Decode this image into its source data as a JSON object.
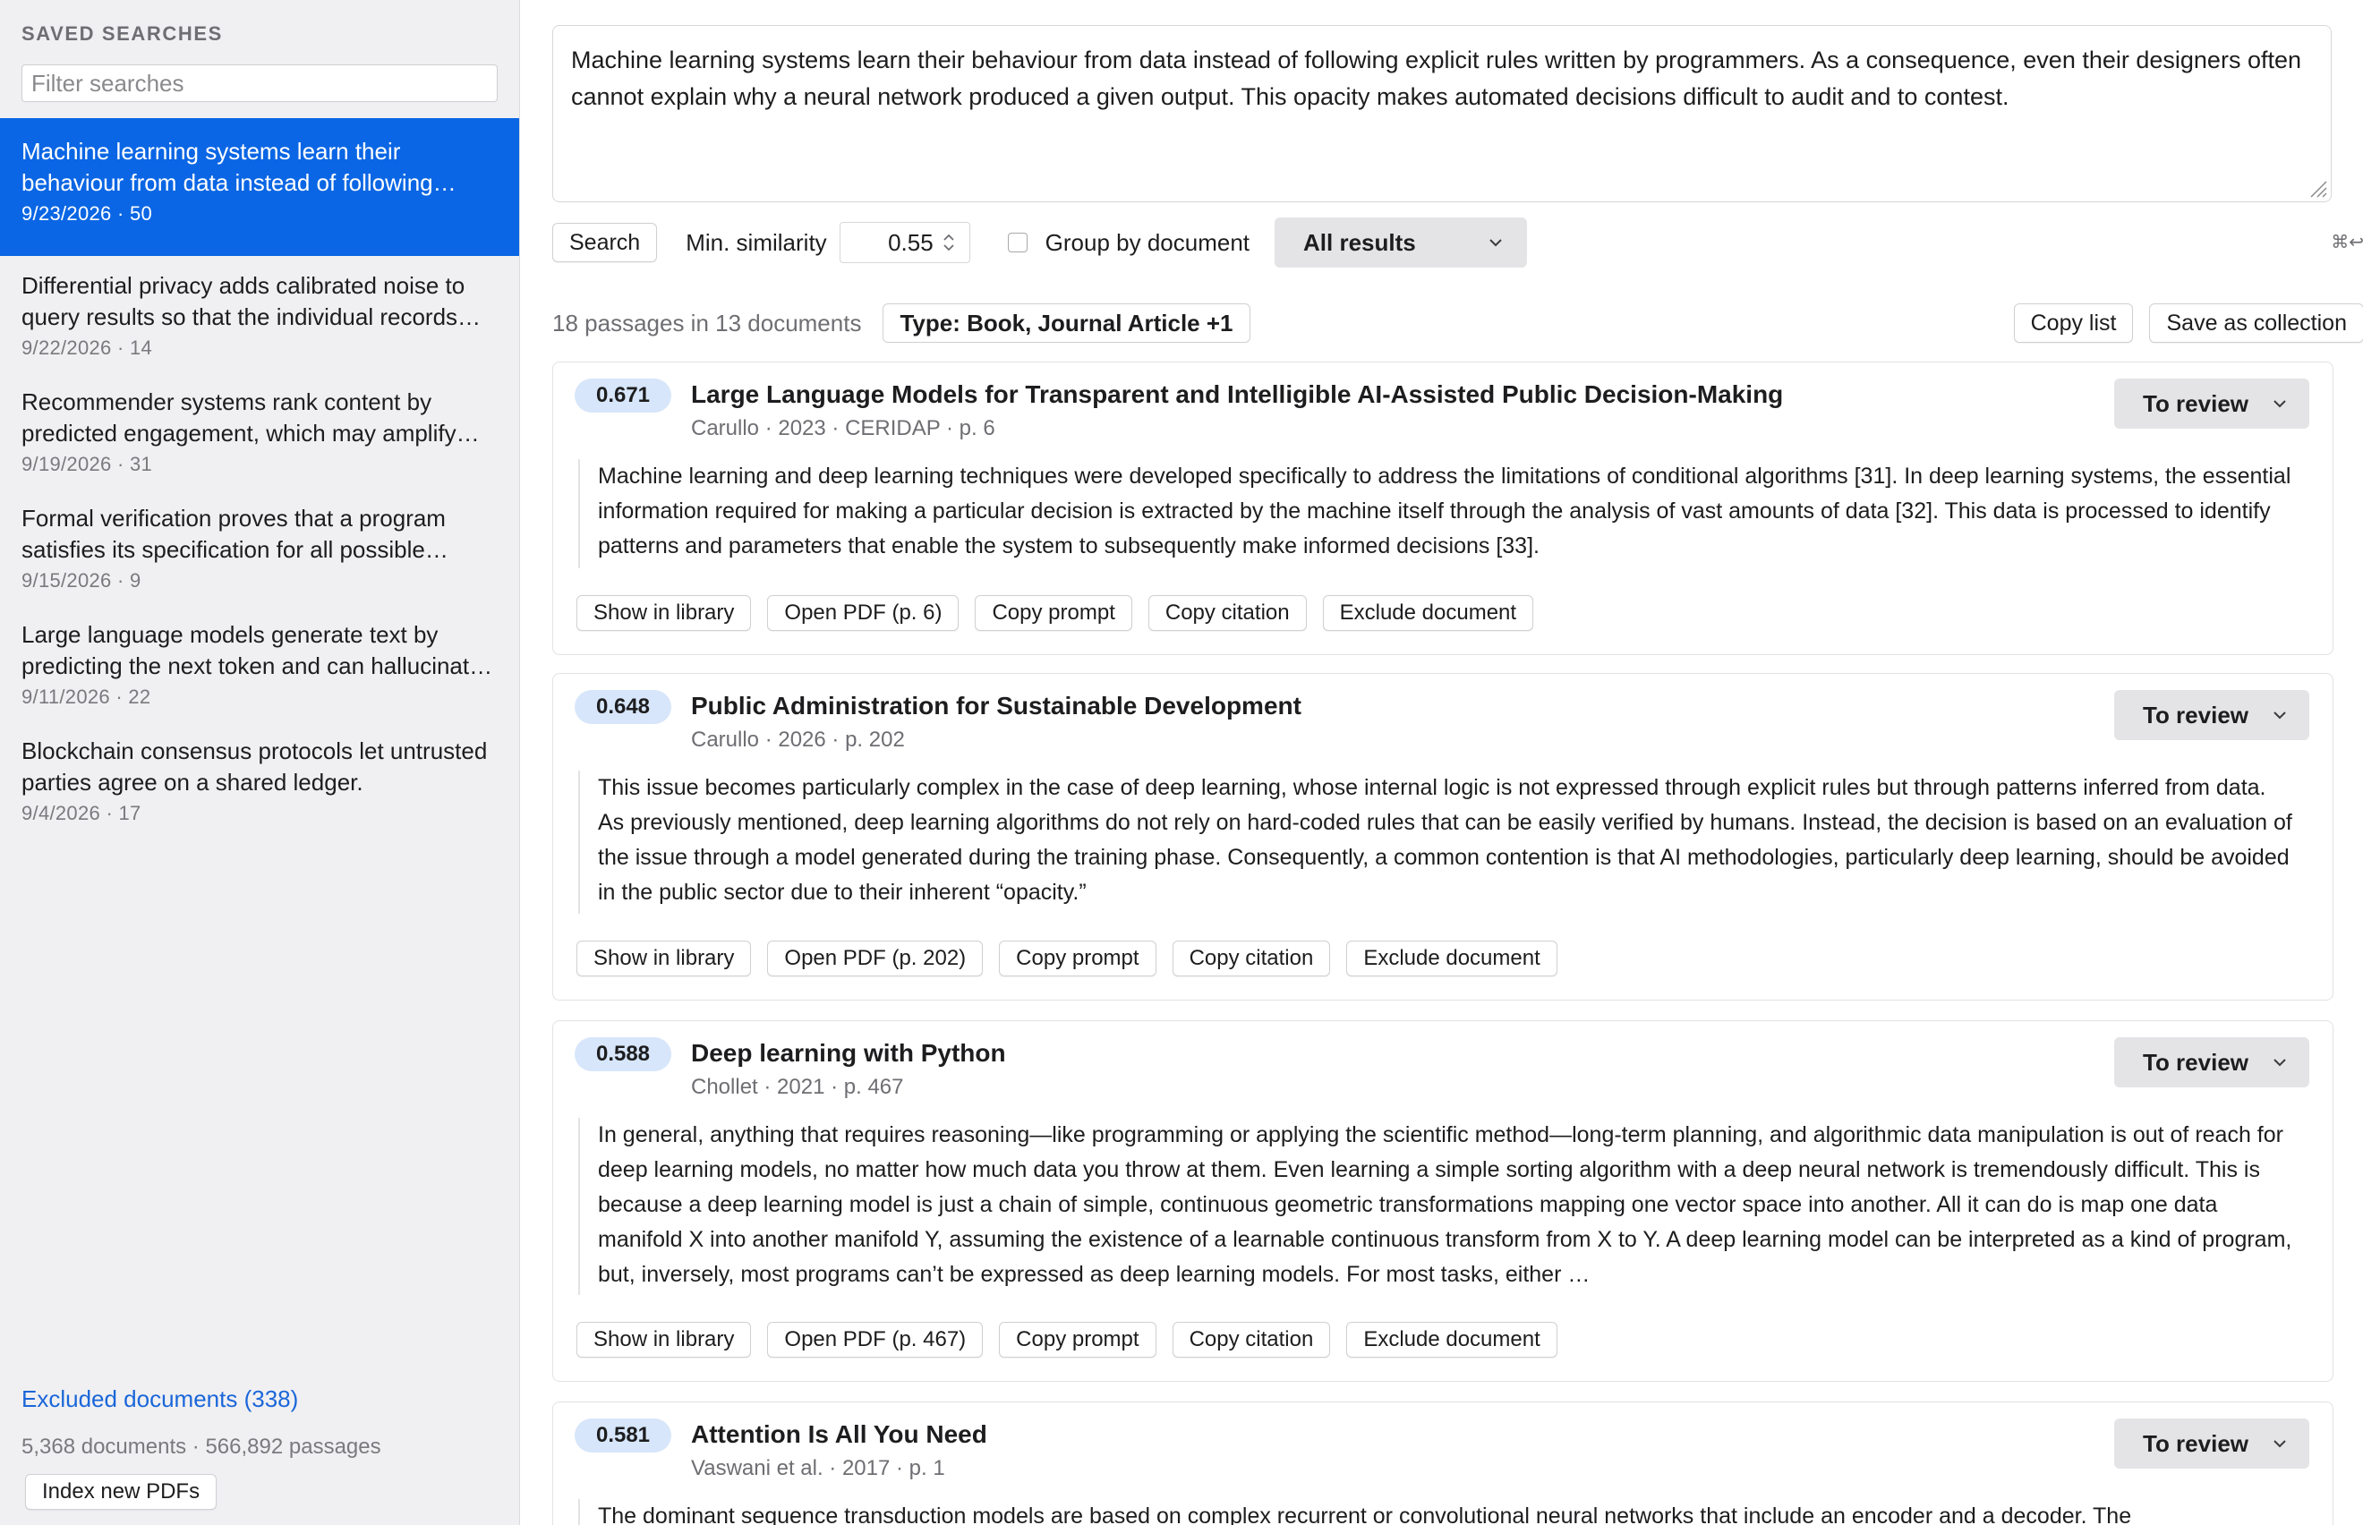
{
  "sidebar": {
    "header": "SAVED SEARCHES",
    "filter_placeholder": "Filter searches",
    "items": [
      {
        "title": "Machine learning systems learn their behaviour from data instead of following explicit rules written by programmers.",
        "meta": "9/23/2026 · 50",
        "active": true
      },
      {
        "title": "Differential privacy adds calibrated noise to query results so that the individual records cannot be identified.",
        "meta": "9/22/2026 · 14"
      },
      {
        "title": "Recommender systems rank content by predicted engagement, which may amplify extreme content.",
        "meta": "9/19/2026 · 31"
      },
      {
        "title": "Formal verification proves that a program satisfies its specification for all possible inputs.",
        "meta": "9/15/2026 · 9"
      },
      {
        "title": "Large language models generate text by predicting the next token and can hallucinate facts.",
        "meta": "9/11/2026 · 22"
      },
      {
        "title": "Blockchain consensus protocols let untrusted parties agree on a shared ledger.",
        "meta": "9/4/2026 · 17"
      }
    ],
    "excluded_label": "Excluded documents (338)",
    "stats": "5,368 documents · 566,892 passages",
    "index_button": "Index new PDFs"
  },
  "query": {
    "text": "Machine learning systems learn their behaviour from data instead of following explicit rules written by programmers. As a consequence, even their designers often cannot explain why a neural network produced a given output. This opacity makes automated decisions difficult to audit and to contest."
  },
  "controls": {
    "search_button": "Search",
    "min_similarity_label": "Min. similarity",
    "min_similarity_value": "0.55",
    "group_by_label": "Group by document",
    "group_by_checked": false,
    "results_filter": "All results",
    "shortcut_hint": "⌘↩"
  },
  "results": {
    "count_text": "18 passages in 13 documents",
    "type_filter": "Type: Book, Journal Article +1",
    "copy_list": "Copy list",
    "save_collection": "Save as collection",
    "cards": [
      {
        "score": "0.671",
        "title": "Large Language Models for Transparent and Intelligible AI-Assisted Public Decision-Making",
        "meta": "Carullo · 2023 · CERIDAP · p. 6",
        "status": "To review",
        "excerpt": "Machine learning and deep learning techniques were developed specifically to address the limitations of conditional algorithms [31]. In deep learning systems, the essential information required for making a particular decision is extracted by the machine itself through the analysis of vast amounts of data [32]. This data is processed to identify patterns and parameters that enable the system to subsequently make informed decisions [33].",
        "actions": [
          "Show in library",
          "Open PDF (p. 6)",
          "Copy prompt",
          "Copy citation",
          "Exclude document"
        ]
      },
      {
        "score": "0.648",
        "title": "Public Administration for Sustainable Development",
        "meta": "Carullo · 2026 · p. 202",
        "status": "To review",
        "excerpt": "This issue becomes particularly complex in the case of deep learning, whose internal logic is not expressed through explicit rules but through patterns inferred from data. As previously mentioned, deep learning algorithms do not rely on hard-coded rules that can be easily verified by humans. Instead, the decision is based on an evaluation of the issue through a model generated during the training phase. Consequently, a common contention is that AI methodologies, particularly deep learning, should be avoided in the public sector due to their inherent “opacity.”",
        "actions": [
          "Show in library",
          "Open PDF (p. 202)",
          "Copy prompt",
          "Copy citation",
          "Exclude document"
        ]
      },
      {
        "score": "0.588",
        "title": "Deep learning with Python",
        "meta": "Chollet · 2021 · p. 467",
        "status": "To review",
        "excerpt": "In general, anything that requires reasoning—like programming or applying the scientific method—long-term planning, and algorithmic data manipulation is out of reach for deep learning models, no matter how much data you throw at them. Even learning a simple sorting algorithm with a deep neural network is tremendously difficult. This is because a deep learning model is just a chain of simple, continuous geometric transformations mapping one vector space into another. All it can do is map one data manifold X into another manifold Y, assuming the existence of a learnable continuous transform from X to Y. A deep learning model can be interpreted as a kind of program, but, inversely, most programs can’t be expressed as deep learning models. For most tasks, either …",
        "actions": [
          "Show in library",
          "Open PDF (p. 467)",
          "Copy prompt",
          "Copy citation",
          "Exclude document"
        ]
      },
      {
        "score": "0.581",
        "title": "Attention Is All You Need",
        "meta": "Vaswani et al. · 2017 · p. 1",
        "status": "To review",
        "excerpt": "The dominant sequence transduction models are based on complex recurrent or convolutional neural networks that include an encoder and a decoder. The",
        "actions": []
      }
    ]
  },
  "colors": {
    "accent": "#0a66e4",
    "score_badge": "#d7e6fa",
    "link": "#1a66d9",
    "sidebar_bg": "#f0f0f2"
  }
}
